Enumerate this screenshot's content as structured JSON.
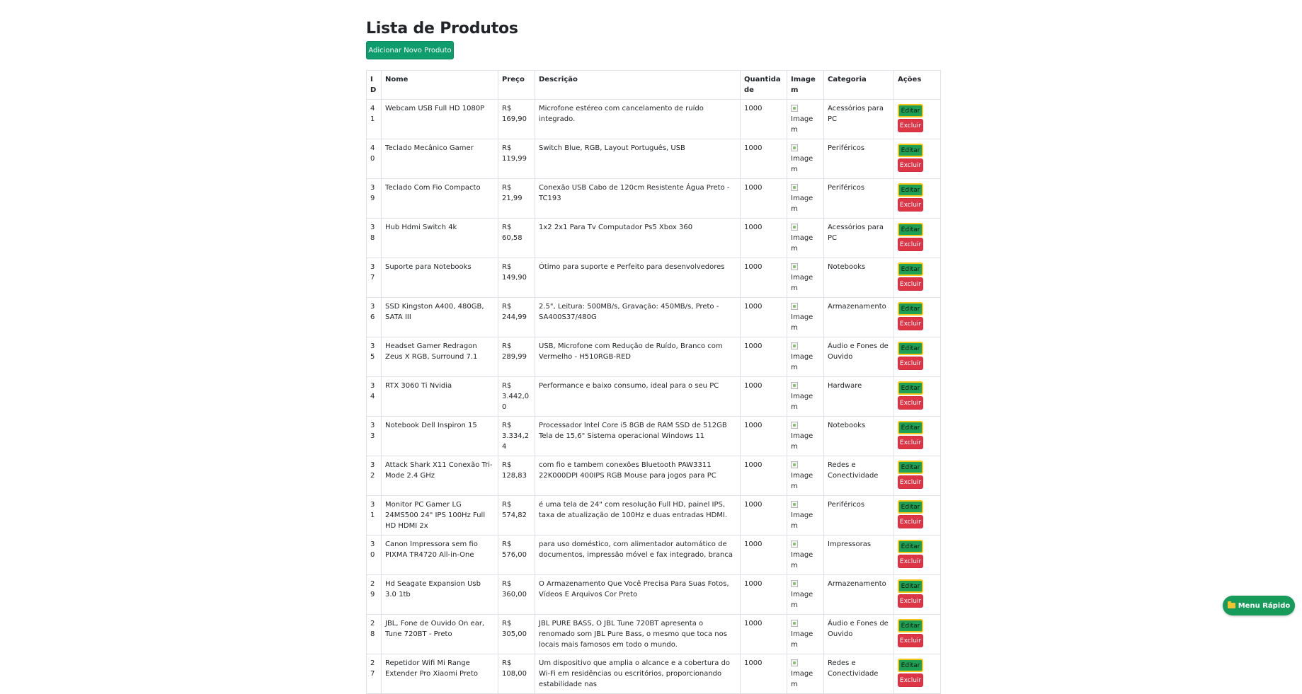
{
  "page": {
    "title": "Lista de Produtos"
  },
  "actions": {
    "add_label": "Adicionar Novo Produto"
  },
  "table": {
    "headers": [
      "ID",
      "Nome",
      "Preço",
      "Descrição",
      "Quantidade",
      "Imagem",
      "Categoria",
      "Ações"
    ],
    "edit_label": "Editar",
    "delete_label": "Excluir",
    "rows": [
      {
        "id": "41",
        "name": "Webcam USB Full HD 1080P",
        "price": "R$ 169,90",
        "description": "Microfone estéreo com cancelamento de ruído integrado.",
        "quantity": "1000",
        "image_alt": "Imagem",
        "category": "Acessórios para PC"
      },
      {
        "id": "40",
        "name": "Teclado Mecânico Gamer",
        "price": "R$ 119,99",
        "description": "Switch Blue, RGB, Layout Português, USB",
        "quantity": "1000",
        "image_alt": "Imagem",
        "category": "Periféricos"
      },
      {
        "id": "39",
        "name": "Teclado Com Fio Compacto",
        "price": "R$ 21,99",
        "description": "Conexão USB Cabo de 120cm Resistente Água Preto - TC193",
        "quantity": "1000",
        "image_alt": "Imagem",
        "category": "Periféricos"
      },
      {
        "id": "38",
        "name": "Hub Hdmi Switch 4k",
        "price": "R$ 60,58",
        "description": "1x2 2x1 Para Tv Computador Ps5 Xbox 360",
        "quantity": "1000",
        "image_alt": "Imagem",
        "category": "Acessórios para PC"
      },
      {
        "id": "37",
        "name": "Suporte para Notebooks",
        "price": "R$ 149,90",
        "description": "Ótimo para suporte e Perfeito para desenvolvedores",
        "quantity": "1000",
        "image_alt": "Imagem",
        "category": "Notebooks"
      },
      {
        "id": "36",
        "name": "SSD Kingston A400, 480GB, SATA III",
        "price": "R$ 244,99",
        "description": "2.5\", Leitura: 500MB/s, Gravação: 450MB/s, Preto - SA400S37/480G",
        "quantity": "1000",
        "image_alt": "Imagem",
        "category": "Armazenamento"
      },
      {
        "id": "35",
        "name": "Headset Gamer Redragon Zeus X RGB, Surround 7.1",
        "price": "R$ 289,99",
        "description": "USB, Microfone com Redução de Ruído, Branco com Vermelho - H510RGB-RED",
        "quantity": "1000",
        "image_alt": "Imagem",
        "category": "Áudio e Fones de Ouvido"
      },
      {
        "id": "34",
        "name": "RTX 3060 Ti Nvidia",
        "price": "R$ 3.442,00",
        "description": "Performance e baixo consumo, ideal para o seu PC",
        "quantity": "1000",
        "image_alt": "Imagem",
        "category": "Hardware"
      },
      {
        "id": "33",
        "name": "Notebook Dell Inspiron 15",
        "price": "R$ 3.334,24",
        "description": "Processador Intel Core i5 8GB de RAM SSD de 512GB Tela de 15,6\" Sistema operacional Windows 11",
        "quantity": "1000",
        "image_alt": "Imagem",
        "category": "Notebooks"
      },
      {
        "id": "32",
        "name": "Attack Shark X11 Conexão Tri-Mode 2.4 GHz",
        "price": "R$ 128,83",
        "description": "com fio e tambem conexões Bluetooth PAW3311 22K000DPI 400IPS RGB Mouse para jogos para PC",
        "quantity": "1000",
        "image_alt": "Imagem",
        "category": "Redes e Conectividade"
      },
      {
        "id": "31",
        "name": "Monitor PC Gamer LG 24MS500 24\" IPS 100Hz Full HD HDMI 2x",
        "price": "R$ 574,82",
        "description": "é uma tela de 24\" com resolução Full HD, painel IPS, taxa de atualização de 100Hz e duas entradas HDMI.",
        "quantity": "1000",
        "image_alt": "Imagem",
        "category": "Periféricos"
      },
      {
        "id": "30",
        "name": "Canon Impressora sem fio PIXMA TR4720 All-in-One",
        "price": "R$ 576,00",
        "description": "para uso doméstico, com alimentador automático de documentos, impressão móvel e fax integrado, branca",
        "quantity": "1000",
        "image_alt": "Imagem",
        "category": "Impressoras"
      },
      {
        "id": "29",
        "name": "Hd Seagate Expansion Usb 3.0 1tb",
        "price": "R$ 360,00",
        "description": "O Armazenamento Que Você Precisa Para Suas Fotos, Vídeos E Arquivos Cor Preto",
        "quantity": "1000",
        "image_alt": "Imagem",
        "category": "Armazenamento"
      },
      {
        "id": "28",
        "name": "JBL, Fone de Ouvido On ear, Tune 720BT - Preto",
        "price": "R$ 305,00",
        "description": "JBL PURE BASS, O JBL Tune 720BT apresenta o renomado som JBL Pure Bass, o mesmo que toca nos locais mais famosos em todo o mundo.",
        "quantity": "1000",
        "image_alt": "Imagem",
        "category": "Áudio e Fones de Ouvido"
      },
      {
        "id": "27",
        "name": "Repetidor Wifi Mi Range Extender Pro Xiaomi Preto",
        "price": "R$ 108,00",
        "description": "Um dispositivo que amplia o alcance e a cobertura do Wi-Fi em residências ou escritórios, proporcionando estabilidade nas",
        "quantity": "1000",
        "image_alt": "Imagem",
        "category": "Redes e Conectividade"
      }
    ]
  },
  "quick_menu": {
    "label": "Menu Rápido",
    "icon": "folder-icon"
  }
}
